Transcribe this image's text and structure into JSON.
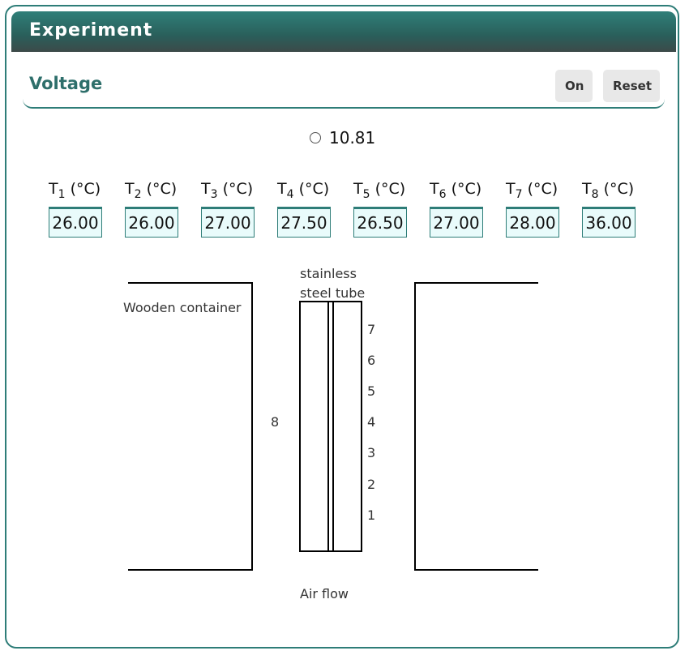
{
  "panel": {
    "title": "Experiment"
  },
  "voltage": {
    "title": "Voltage",
    "value": "10.81"
  },
  "buttons": {
    "on": "On",
    "reset": "Reset"
  },
  "temperatures": [
    {
      "label_prefix": "T",
      "index": "1",
      "unit": " (°C)",
      "value": "26.00"
    },
    {
      "label_prefix": "T",
      "index": "2",
      "unit": " (°C)",
      "value": "26.00"
    },
    {
      "label_prefix": "T",
      "index": "3",
      "unit": " (°C)",
      "value": "27.00"
    },
    {
      "label_prefix": "T",
      "index": "4",
      "unit": " (°C)",
      "value": "27.50"
    },
    {
      "label_prefix": "T",
      "index": "5",
      "unit": " (°C)",
      "value": "26.50"
    },
    {
      "label_prefix": "T",
      "index": "6",
      "unit": " (°C)",
      "value": "27.00"
    },
    {
      "label_prefix": "T",
      "index": "7",
      "unit": " (°C)",
      "value": "28.00"
    },
    {
      "label_prefix": "T",
      "index": "8",
      "unit": " (°C)",
      "value": "36.00"
    }
  ],
  "diagram": {
    "wooden_container": "Wooden container",
    "tube_line1": "stainless",
    "tube_line2": "steel tube",
    "air_flow": "Air flow",
    "sensor_left": "8",
    "sensor_numbers": [
      "7",
      "6",
      "5",
      "4",
      "3",
      "2",
      "1"
    ]
  },
  "colors": {
    "accent": "#2e7d78",
    "box_fill": "#e9fbfb",
    "button_bg": "#e8e8e8"
  }
}
